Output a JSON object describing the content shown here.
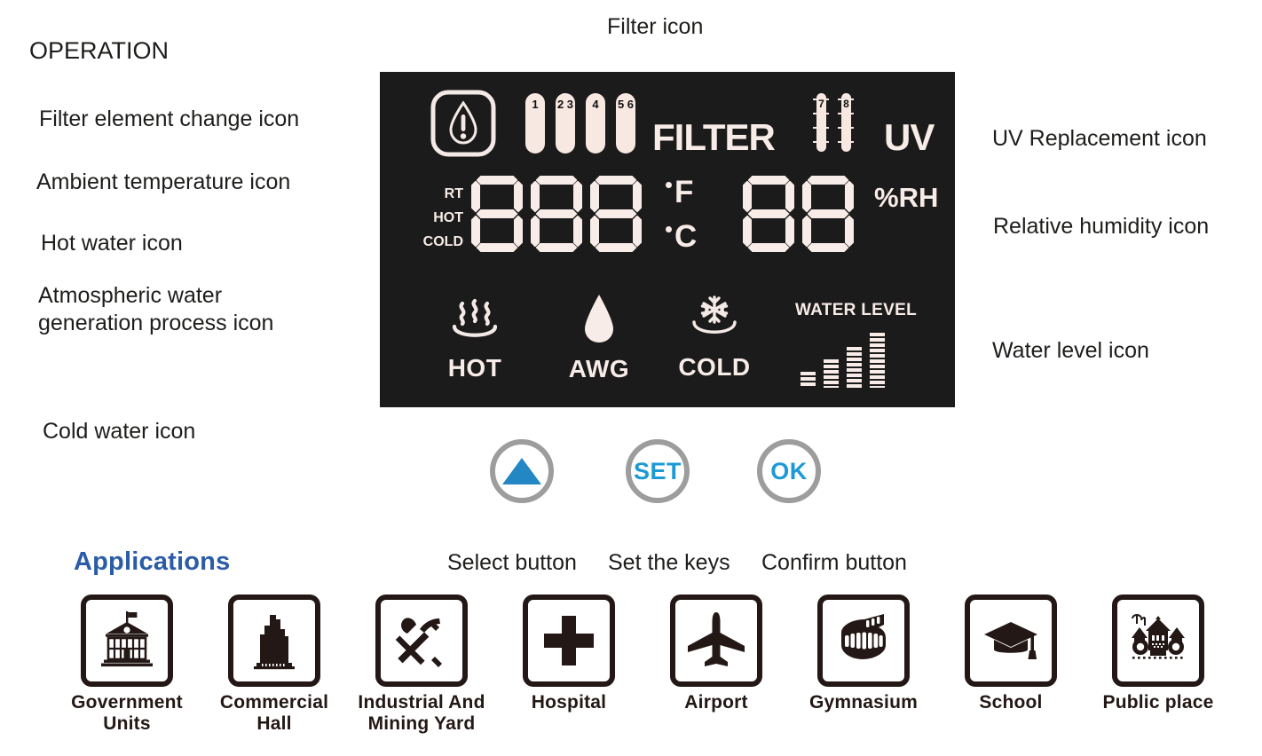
{
  "page": {
    "operation_title": "OPERATION",
    "applications_title": "Applications",
    "accent_blue": "#2b5ca8",
    "button_blue": "#1c9ad6",
    "lcd_background": "#1c1b1b",
    "lcd_foreground": "#f7ece8"
  },
  "callouts": {
    "filter_icon": "Filter icon",
    "filter_element_change": "Filter element change icon",
    "ambient_temperature": "Ambient temperature icon",
    "hot_water": "Hot water icon",
    "awg_process": "Atmospheric water\ngeneration process icon",
    "cold_water": "Cold water icon",
    "uv_replacement": "UV Replacement icon",
    "relative_humidity": "Relative humidity icon",
    "water_level": "Water level icon",
    "select_button": "Select button",
    "set_keys": "Set the keys",
    "confirm_button": "Confirm button"
  },
  "lcd": {
    "filter_change_icon_name": "water-drop-warning-icon",
    "filter_pills": [
      {
        "lines": "1"
      },
      {
        "lines": "2\n3"
      },
      {
        "lines": "4"
      },
      {
        "lines": "5\n6"
      }
    ],
    "filter_word": "FILTER",
    "uv_lamps": [
      {
        "number": "7"
      },
      {
        "number": "8"
      }
    ],
    "uv_word": "UV",
    "mode_labels": [
      "RT",
      "HOT",
      "COLD"
    ],
    "temperature_digits": [
      "8",
      "8",
      "8"
    ],
    "humidity_digits": [
      "8",
      "8"
    ],
    "unit_fahrenheit": "F",
    "unit_celsius": "C",
    "humidity_unit": "%RH",
    "status": [
      {
        "label": "HOT",
        "icon": "steam-waves-icon"
      },
      {
        "label": "AWG",
        "icon": "water-drop-icon"
      },
      {
        "label": "COLD",
        "icon": "snowflake-icon"
      }
    ],
    "water_level_caption": "WATER LEVEL",
    "water_level_bars": [
      18,
      32,
      46,
      62
    ],
    "water_level_active": 4
  },
  "controls": [
    {
      "name": "up-button",
      "label": "",
      "icon": "triangle-up-icon"
    },
    {
      "name": "set-button",
      "label": "SET",
      "icon": ""
    },
    {
      "name": "ok-button",
      "label": "OK",
      "icon": ""
    }
  ],
  "applications": [
    {
      "label": "Government\nUnits",
      "icon": "government-building-icon"
    },
    {
      "label": "Commercial\nHall",
      "icon": "skyscraper-icon"
    },
    {
      "label": "Industrial And\nMining Yard",
      "icon": "shovel-pickaxe-icon"
    },
    {
      "label": "Hospital",
      "icon": "medical-cross-icon"
    },
    {
      "label": "Airport",
      "icon": "airplane-icon"
    },
    {
      "label": "Gymnasium",
      "icon": "stadium-icon"
    },
    {
      "label": "School",
      "icon": "graduation-cap-icon"
    },
    {
      "label": "Public place",
      "icon": "town-scene-icon"
    }
  ]
}
